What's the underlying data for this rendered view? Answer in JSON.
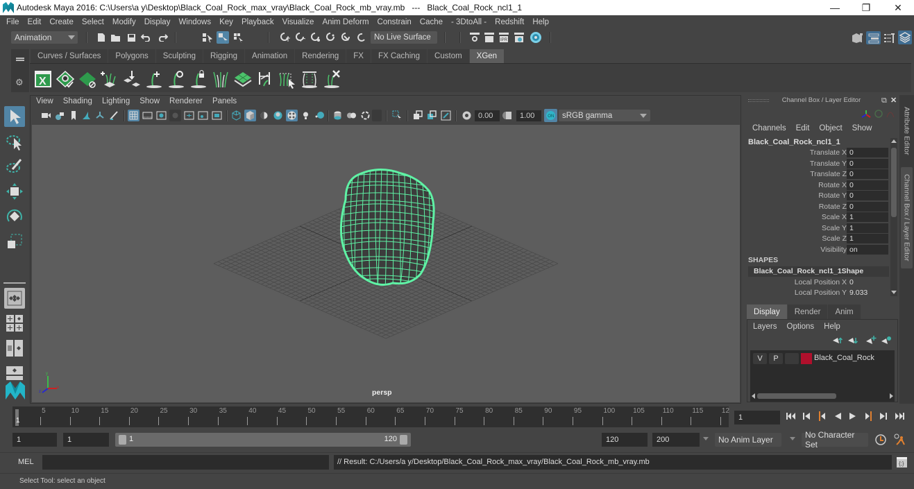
{
  "window": {
    "title": "Autodesk Maya 2016: C:\\Users\\a y\\Desktop\\Black_Coal_Rock_max_vray\\Black_Coal_Rock_mb_vray.mb   ---   Black_Coal_Rock_ncl1_1",
    "minimize": "—",
    "maximize": "❐",
    "close": "✕"
  },
  "menubar": [
    "File",
    "Edit",
    "Create",
    "Select",
    "Modify",
    "Display",
    "Windows",
    "Key",
    "Playback",
    "Visualize",
    "Anim Deform",
    "Constrain",
    "Cache",
    "- 3DtoAll -",
    "Redshift",
    "Help"
  ],
  "statusline": {
    "mode": "Animation",
    "live_surface": "No Live Surface"
  },
  "shelf": {
    "tabs": [
      "Curves / Surfaces",
      "Polygons",
      "Sculpting",
      "Rigging",
      "Animation",
      "Rendering",
      "FX",
      "FX Caching",
      "Custom",
      "XGen"
    ],
    "active_tab": "XGen",
    "icons": [
      "xgen-window-icon",
      "xgen-preview-icon",
      "xgen-clear-preview-icon",
      "xgen-add-guides-icon",
      "xgen-place-guides-icon",
      "xgen-add-guide-icon",
      "xgen-sculpt-guide-icon",
      "xgen-lock-guide-icon",
      "xgen-guide-length-icon",
      "xgen-attribute-map-icon",
      "xgen-bend-guide-icon",
      "xgen-select-guide-icon",
      "xgen-guide-shape-icon",
      "xgen-delete-guide-icon"
    ]
  },
  "viewport": {
    "menu": [
      "View",
      "Shading",
      "Lighting",
      "Show",
      "Renderer",
      "Panels"
    ],
    "exposure": "0.00",
    "gamma": "1.00",
    "color_space": "sRGB gamma",
    "camera_label": "persp",
    "axis": {
      "x": "x",
      "y": "y",
      "z": "z"
    },
    "wire_color": "#5ff2a5"
  },
  "channel_box": {
    "title": "Channel Box / Layer Editor",
    "menu": [
      "Channels",
      "Edit",
      "Object",
      "Show"
    ],
    "object_name": "Black_Coal_Rock_ncl1_1",
    "attributes": [
      {
        "label": "Translate X",
        "value": "0"
      },
      {
        "label": "Translate Y",
        "value": "0"
      },
      {
        "label": "Translate Z",
        "value": "0"
      },
      {
        "label": "Rotate X",
        "value": "0"
      },
      {
        "label": "Rotate Y",
        "value": "0"
      },
      {
        "label": "Rotate Z",
        "value": "0"
      },
      {
        "label": "Scale X",
        "value": "1"
      },
      {
        "label": "Scale Y",
        "value": "1"
      },
      {
        "label": "Scale Z",
        "value": "1"
      },
      {
        "label": "Visibility",
        "value": "on"
      }
    ],
    "shapes_header": "SHAPES",
    "shape_name": "Black_Coal_Rock_ncl1_1Shape",
    "shape_attributes": [
      {
        "label": "Local Position X",
        "value": "0"
      },
      {
        "label": "Local Position Y",
        "value": "9.033"
      }
    ]
  },
  "side_tabs": [
    "Attribute Editor",
    "Channel Box / Layer Editor"
  ],
  "layer_editor": {
    "tabs": [
      "Display",
      "Render",
      "Anim"
    ],
    "active_tab": "Display",
    "menu": [
      "Layers",
      "Options",
      "Help"
    ],
    "layers": [
      {
        "v": "V",
        "p": "P",
        "name": "Black_Coal_Rock",
        "color": "#b0102c"
      }
    ]
  },
  "time_slider": {
    "ticks": [
      "5",
      "10",
      "15",
      "20",
      "25",
      "30",
      "35",
      "40",
      "45",
      "50",
      "55",
      "60",
      "65",
      "70",
      "75",
      "80",
      "85",
      "90",
      "95",
      "100",
      "105",
      "110",
      "115",
      "12"
    ],
    "current_frame_marker": "1",
    "current_frame": "1"
  },
  "range_slider": {
    "start_time": "1",
    "playback_start": "1",
    "range_start_label": "1",
    "range_end_label": "120",
    "playback_end": "120",
    "end_time": "200",
    "anim_layer": "No Anim Layer",
    "character_set": "No Character Set"
  },
  "command_line": {
    "language": "MEL",
    "input": "",
    "result": "// Result: C:/Users/a y/Desktop/Black_Coal_Rock_max_vray/Black_Coal_Rock_mb_vray.mb"
  },
  "help_line": "Select Tool: select an object"
}
